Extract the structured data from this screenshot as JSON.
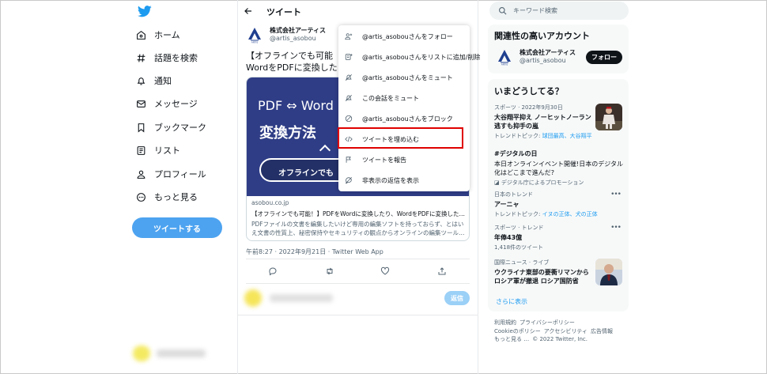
{
  "colors": {
    "accent": "#1d9bf0",
    "tweet_button": "#4da3f0",
    "highlight": "#e00000",
    "card_bg": "#2f3d86"
  },
  "nav": {
    "logo_icon": "twitter-bird-icon",
    "items": [
      {
        "label": "ホーム",
        "icon": "home-icon"
      },
      {
        "label": "話題を検索",
        "icon": "hashtag-icon"
      },
      {
        "label": "通知",
        "icon": "bell-icon"
      },
      {
        "label": "メッセージ",
        "icon": "envelope-icon"
      },
      {
        "label": "ブックマーク",
        "icon": "bookmark-icon"
      },
      {
        "label": "リスト",
        "icon": "list-icon"
      },
      {
        "label": "プロフィール",
        "icon": "person-icon"
      },
      {
        "label": "もっと見る",
        "icon": "more-circle-icon"
      }
    ],
    "tweet_button": "ツイートする"
  },
  "header": {
    "title": "ツイート"
  },
  "tweet": {
    "author_name": "株式会社アーティス",
    "author_handle": "@artis_asobou",
    "text_line1": "【オフラインでも可能",
    "text_line2": "WordをPDFに変換した",
    "card": {
      "image_line1": "PDF ⇔ Word",
      "image_line2": "変換方法",
      "image_pill": "オフラインでも",
      "domain": "asobou.co.jp",
      "title": "【オフラインでも可能！】PDFをWordに変換したり、WordをPDFに変換した…",
      "description": "PDFファイルの文書を編集したいけど専用の編集ソフトを持っておらず、とはいえ文書の性質上、秘密保持やセキュリティの観点からオンラインの編集ツール…"
    },
    "timestamp": "午前8:27 · 2022年9月21日 · Twitter Web App",
    "reply_button": "返信"
  },
  "menu": {
    "items": [
      {
        "label": "@artis_asobouさんをフォロー",
        "icon": "follow-icon"
      },
      {
        "label": "@artis_asobouさんをリストに追加/削除",
        "icon": "list-add-icon"
      },
      {
        "label": "@artis_asobouさんをミュート",
        "icon": "mute-icon"
      },
      {
        "label": "この会話をミュート",
        "icon": "mute-icon"
      },
      {
        "label": "@artis_asobouさんをブロック",
        "icon": "block-icon"
      },
      {
        "label": "ツイートを埋め込む",
        "icon": "embed-code-icon"
      },
      {
        "label": "ツイートを報告",
        "icon": "flag-icon"
      },
      {
        "label": "非表示の返信を表示",
        "icon": "hidden-reply-icon"
      }
    ]
  },
  "search": {
    "placeholder": "キーワード検索"
  },
  "related": {
    "title": "関連性の高いアカウント",
    "name": "株式会社アーティス",
    "handle": "@artis_asobou",
    "follow": "フォロー"
  },
  "trends": {
    "title": "いまどうしてる？",
    "items": [
      {
        "category": "スポーツ · 2022年9月30日",
        "title_line1": "大谷翔平抑え ノーヒットノーラン",
        "title_line2": "逃すも抑手の嵐",
        "sub_prefix": "トレンドトピック: ",
        "sub_link": "球団最高、大谷翔平"
      },
      {
        "title": "#デジタルの日",
        "body_line1": "本日オンラインイベント開催!日本のデジタル",
        "body_line2": "化はどこまで進んだ?",
        "promo": "デジタル庁によるプロモーション"
      },
      {
        "category": "日本のトレンド",
        "title": "アーニャ",
        "sub_prefix": "トレンドトピック: ",
        "sub_link": "イヌの正体、犬の正体"
      },
      {
        "category": "スポーツ · トレンド",
        "title": "年俸43億",
        "sub": "1,418件のツイート"
      },
      {
        "category": "国際ニュース · ライブ",
        "title_line1": "ウクライナ東部の要衝リマンから",
        "title_line2": "ロシア軍が撤退 ロシア国防省"
      }
    ],
    "show_more": "さらに表示"
  },
  "footer": {
    "links": [
      "利用規約",
      "プライバシーポリシー",
      "Cookieのポリシー",
      "アクセシビリティ",
      "広告情報",
      "もっと見る …",
      "© 2022 Twitter, Inc."
    ]
  }
}
